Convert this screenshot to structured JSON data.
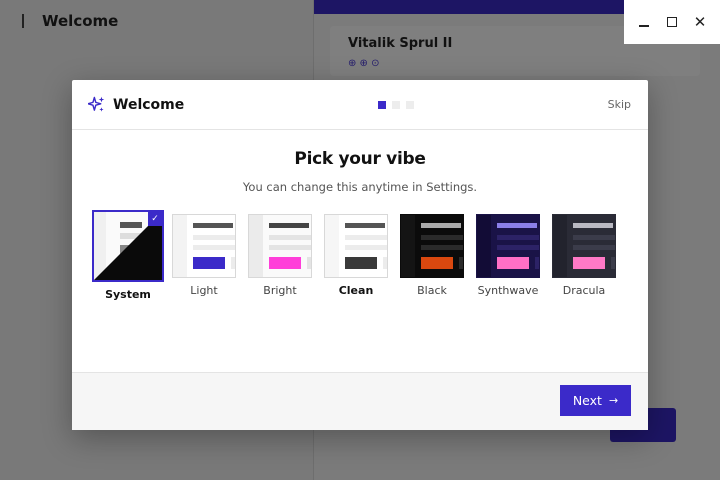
{
  "background": {
    "sidebar_title": "Welcome",
    "card_title": "Vitalik Sprul II",
    "card_sub": "⊕ ⊕ ⊙"
  },
  "window": {
    "controls": [
      {
        "name": "minimize-button",
        "glyph": "—"
      },
      {
        "name": "maximize-button",
        "glyph": "□"
      },
      {
        "name": "close-button",
        "glyph": "✕"
      }
    ]
  },
  "dialog": {
    "title": "Welcome",
    "skip_label": "Skip",
    "steps_total": 3,
    "step_current": 1,
    "heading": "Pick your vibe",
    "subheading": "You can change this anytime in Settings.",
    "next_label": "Next",
    "next_icon": "→"
  },
  "themes": [
    {
      "label": "System",
      "selected": true
    },
    {
      "label": "Light",
      "selected": false
    },
    {
      "label": "Bright",
      "selected": false
    },
    {
      "label": "Clean",
      "selected": false
    },
    {
      "label": "Black",
      "selected": false
    },
    {
      "label": "Synthwave",
      "selected": false
    },
    {
      "label": "Dracula",
      "selected": false
    }
  ],
  "colors": {
    "accent": "#3b2ac9"
  }
}
